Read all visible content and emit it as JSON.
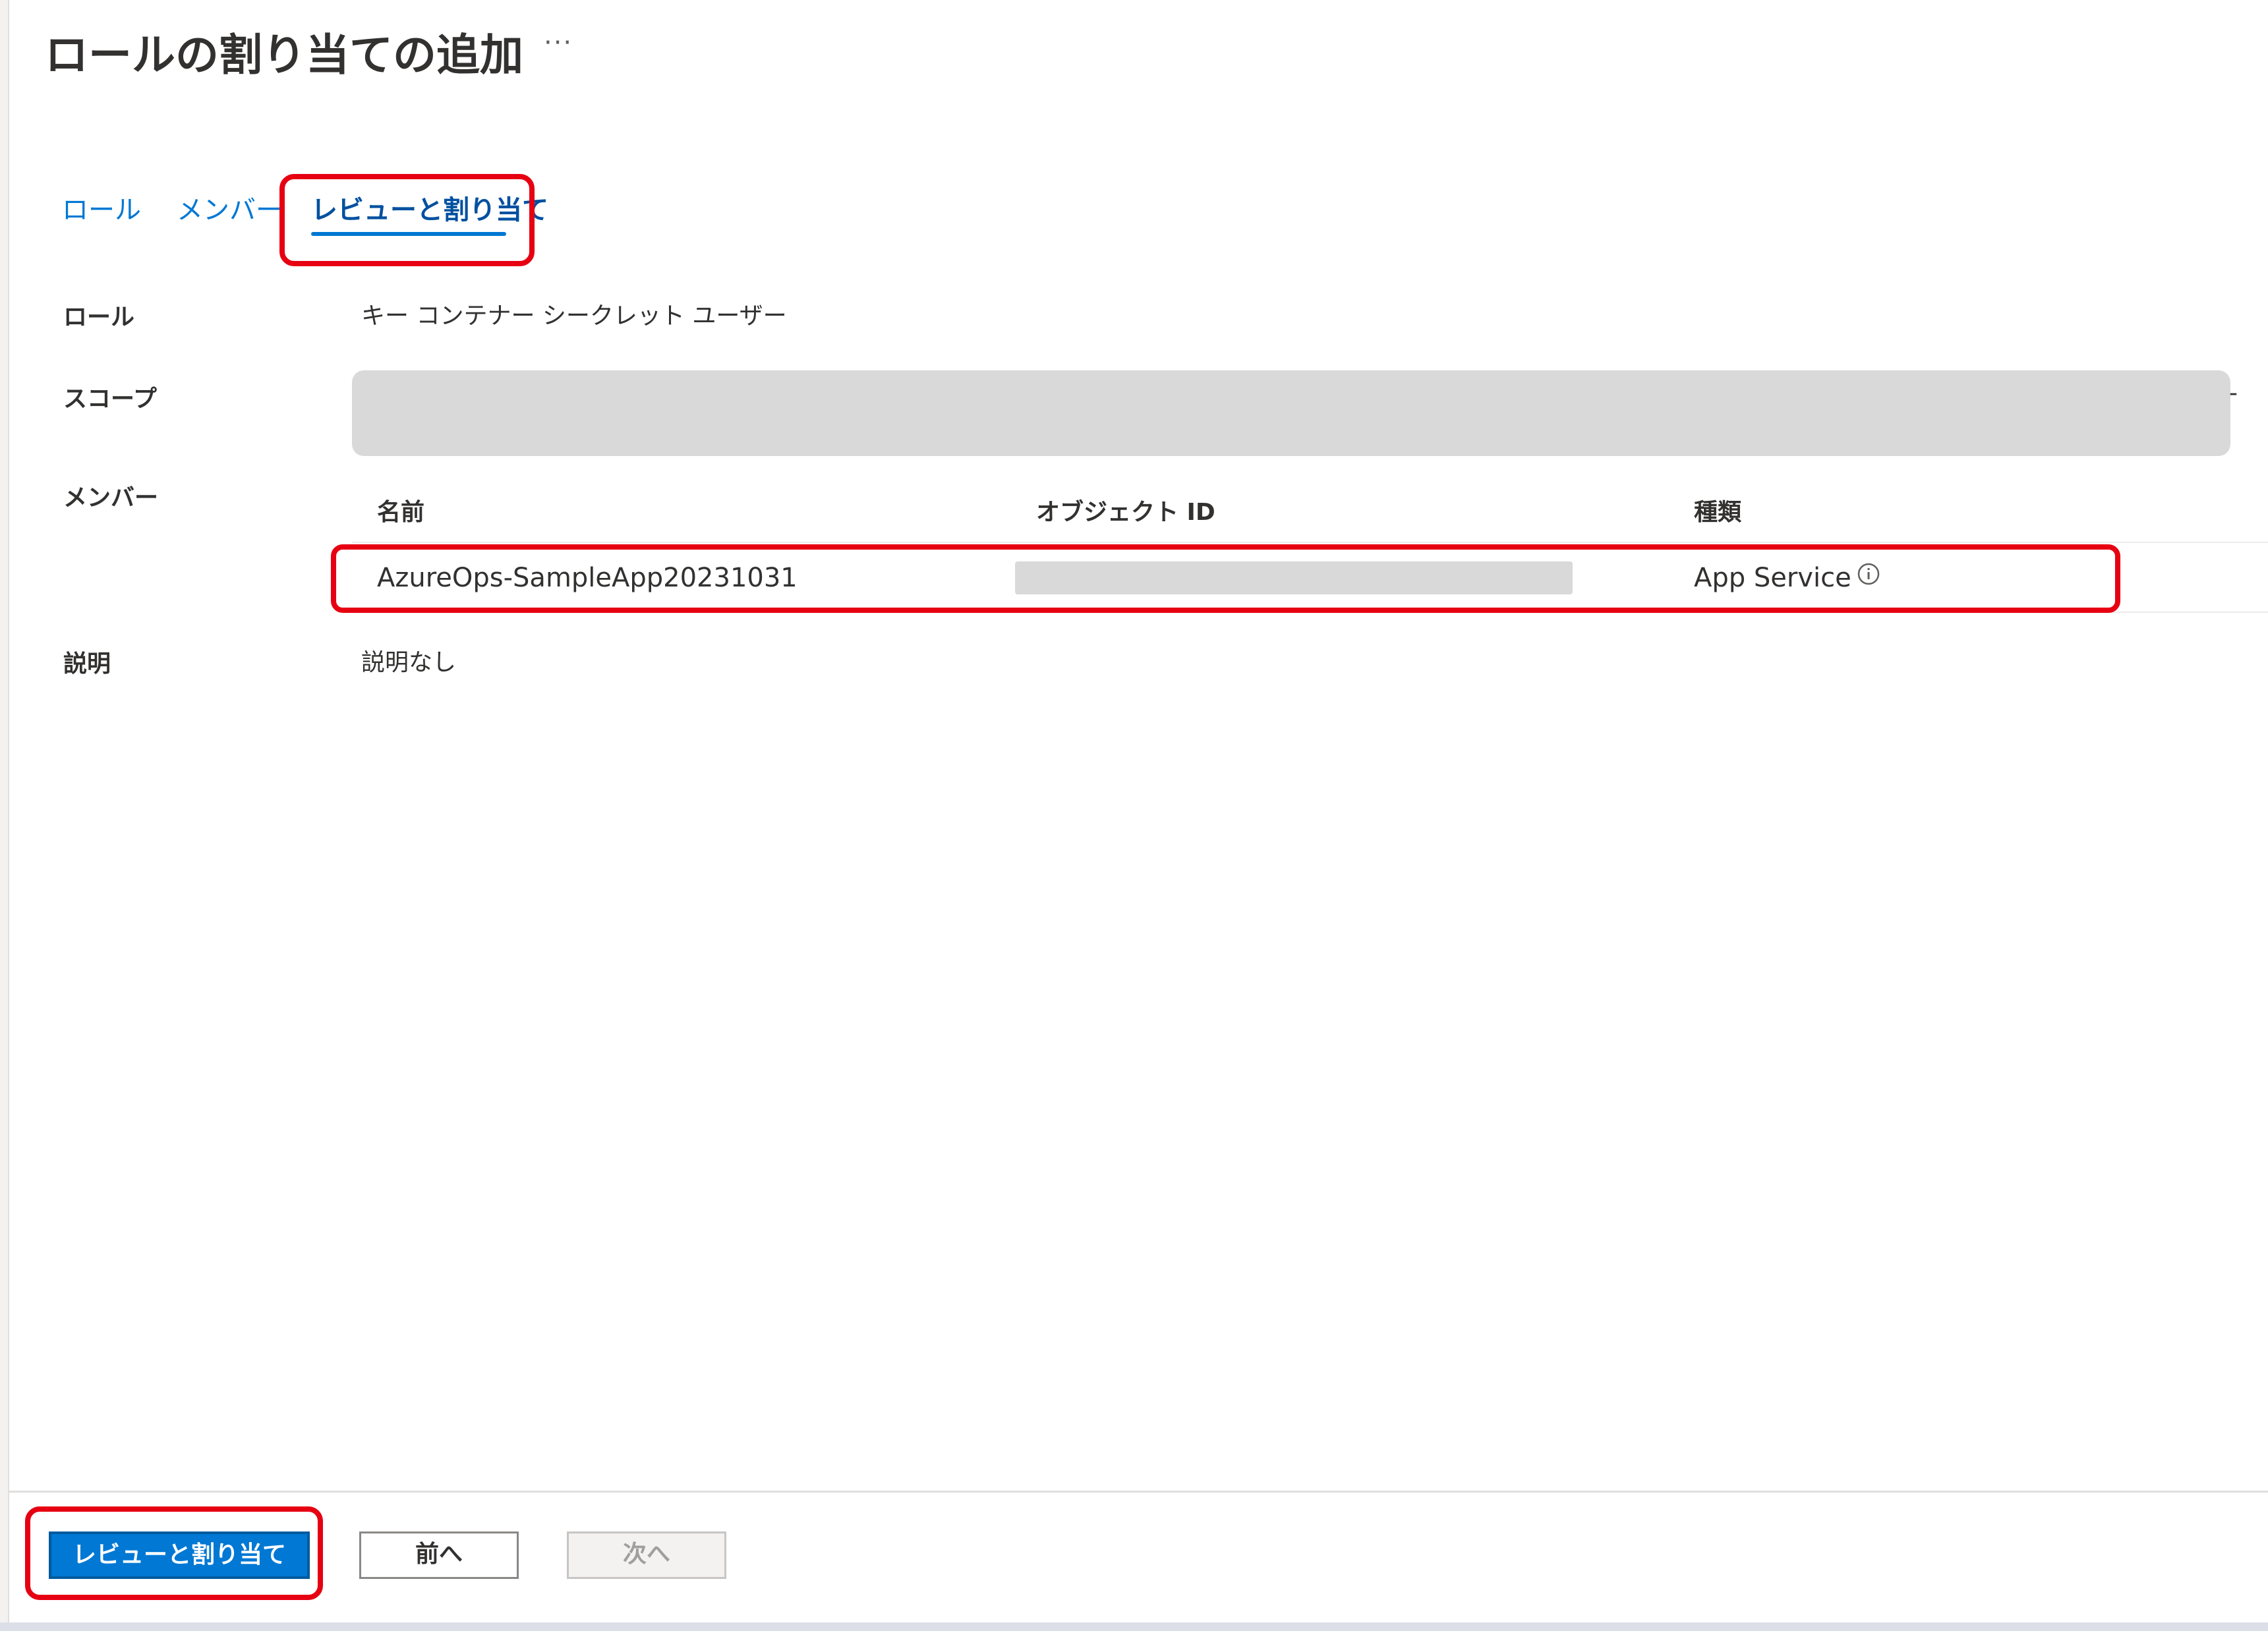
{
  "header": {
    "title": "ロールの割り当ての追加",
    "more_label": "···"
  },
  "tabs": [
    {
      "label": "ロール"
    },
    {
      "label": "メンバー"
    },
    {
      "label": "レビューと割り当て",
      "selected": true
    }
  ],
  "details": {
    "role_label": "ロール",
    "role_value": "キー コンテナー シークレット ユーザー",
    "scope_label": "スコープ",
    "scope_tail": "-",
    "members_label": "メンバー",
    "description_label": "説明",
    "description_value": "説明なし"
  },
  "members_table": {
    "columns": [
      "名前",
      "オブジェクト ID",
      "種類"
    ],
    "rows": [
      {
        "name": "AzureOps-SampleApp20231031",
        "object_id": "",
        "type": "App Service",
        "type_icon": "info-icon"
      }
    ]
  },
  "footer": {
    "primary_label": "レビューと割り当て",
    "prev_label": "前へ",
    "next_label": "次へ"
  },
  "colors": {
    "accent": "#0078d4",
    "highlight": "#e60012",
    "redaction": "#d9d9d9"
  }
}
